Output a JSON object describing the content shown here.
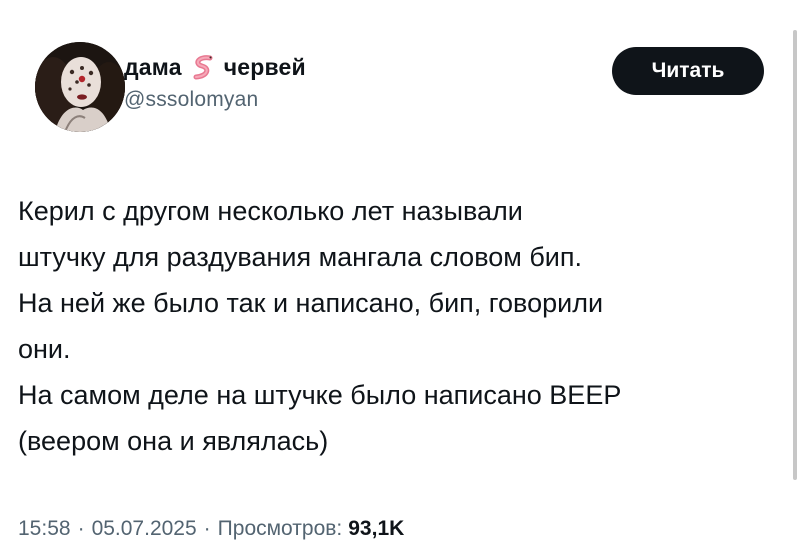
{
  "author": {
    "display_name_part1": "дама",
    "display_name_part2": "червей",
    "emoji": "worm",
    "handle": "@sssolomyan"
  },
  "follow_button": {
    "label": "Читать"
  },
  "tweet": {
    "lines": [
      "Керил с другом несколько лет называли",
      "штучку для раздувания мангала словом бип.",
      "На ней же было так и написано, бип, говорили",
      "они.",
      "На самом деле на штучке было написано BEEP",
      "(веером она и являлась)"
    ]
  },
  "meta": {
    "time": "15:58",
    "separator": "·",
    "date": "05.07.2025",
    "views_label": "Просмотров:",
    "views_count": "93,1K"
  },
  "colors": {
    "text_primary": "#0f1419",
    "text_secondary": "#536471",
    "button_bg": "#0f1419",
    "button_text": "#ffffff",
    "worm_pink": "#f08aa0"
  }
}
